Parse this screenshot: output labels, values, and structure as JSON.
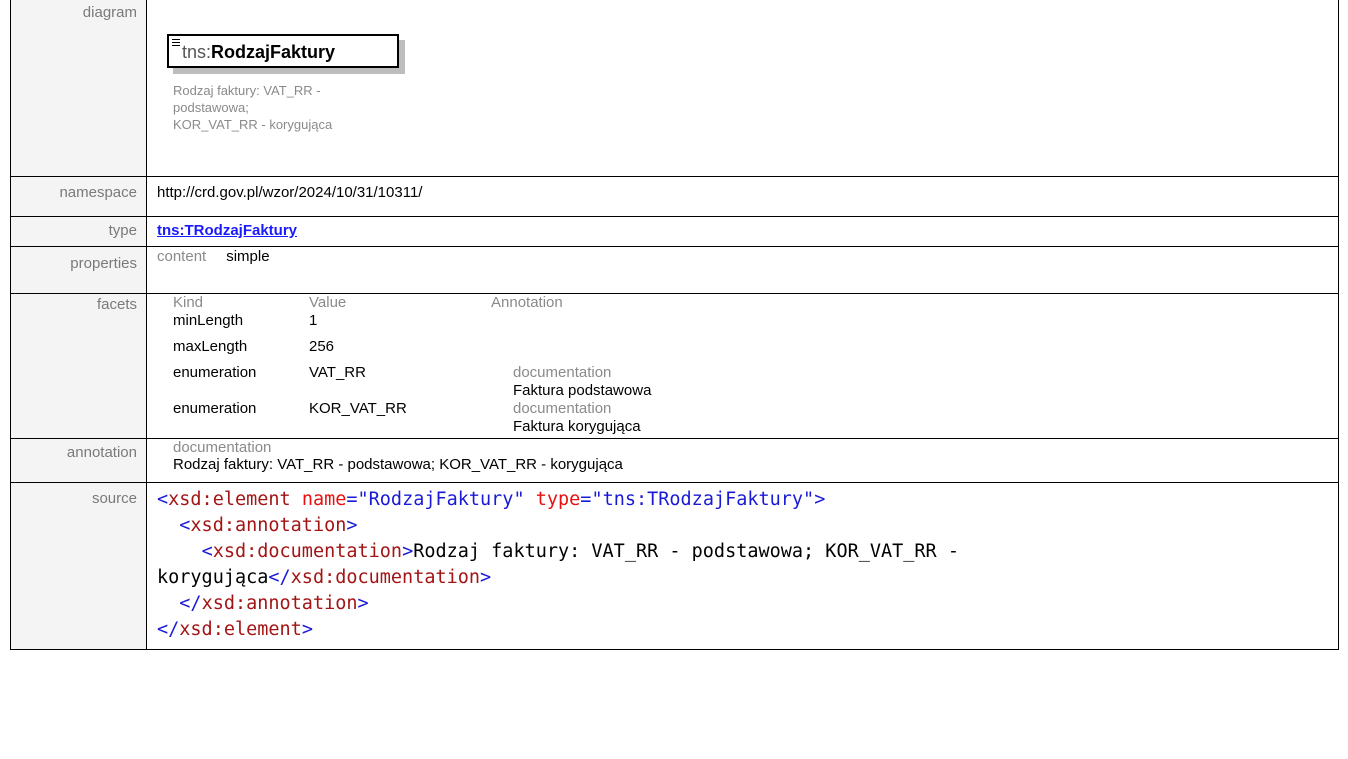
{
  "labels": {
    "diagram": "diagram",
    "namespace": "namespace",
    "type": "type",
    "properties": "properties",
    "facets": "facets",
    "annotation": "annotation",
    "source": "source"
  },
  "diagram": {
    "prefix": "tns:",
    "name": "RodzajFaktury",
    "doc_lines": [
      "Rodzaj faktury: VAT_RR -",
      "podstawowa;",
      "KOR_VAT_RR - korygująca"
    ]
  },
  "namespace": "http://crd.gov.pl/wzor/2024/10/31/10311/",
  "type": "tns:TRodzajFaktury",
  "properties": {
    "key": "content",
    "value": "simple"
  },
  "facets": {
    "headers": [
      "Kind",
      "Value",
      "Annotation"
    ],
    "rows": [
      {
        "kind": "minLength",
        "value": "1",
        "ann_label": "",
        "ann_text": ""
      },
      {
        "kind": "maxLength",
        "value": "256",
        "ann_label": "",
        "ann_text": ""
      },
      {
        "kind": "enumeration",
        "value": "VAT_RR",
        "ann_label": "documentation",
        "ann_text": "Faktura podstawowa"
      },
      {
        "kind": "enumeration",
        "value": "KOR_VAT_RR",
        "ann_label": "documentation",
        "ann_text": "Faktura korygująca"
      }
    ]
  },
  "annotation": {
    "label": "documentation",
    "text": "Rodzaj faktury: VAT_RR - podstawowa; KOR_VAT_RR - korygująca"
  },
  "source": {
    "l1_open": "<",
    "l1_tag": "xsd:element",
    "l1_attr1": "name",
    "l1_eq1": "=",
    "l1_val1": "\"RodzajFaktury\"",
    "l1_attr2": "type",
    "l1_eq2": "=",
    "l1_val2": "\"tns:TRodzajFaktury\"",
    "l1_close": ">",
    "l2_open": "<",
    "l2_tag": "xsd:annotation",
    "l2_close": ">",
    "l3_open": "<",
    "l3_tag": "xsd:documentation",
    "l3_close": ">",
    "l3_text": "Rodzaj faktury: VAT_RR - podstawowa; KOR_VAT_RR -",
    "l4_text": "korygująca",
    "l4_open": "</",
    "l4_tag": "xsd:documentation",
    "l4_close": ">",
    "l5_open": "</",
    "l5_tag": "xsd:annotation",
    "l5_close": ">",
    "l6_open": "</",
    "l6_tag": "xsd:element",
    "l6_close": ">"
  }
}
